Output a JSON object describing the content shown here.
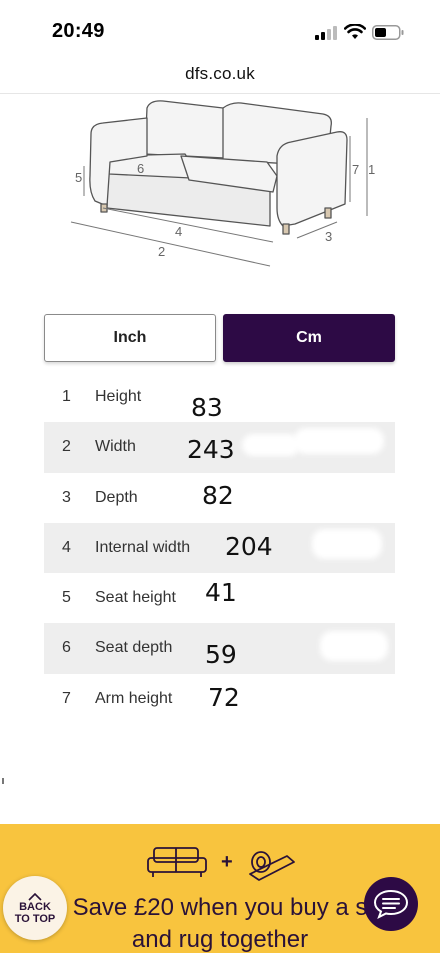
{
  "status_bar": {
    "time": "20:49"
  },
  "browser": {
    "url": "dfs.co.uk"
  },
  "diagram": {
    "labels": [
      "1",
      "2",
      "3",
      "4",
      "5",
      "6",
      "7"
    ]
  },
  "unit_toggle": {
    "options": [
      {
        "label": "Inch",
        "selected": false
      },
      {
        "label": "Cm",
        "selected": true
      }
    ]
  },
  "dimensions": [
    {
      "num": "1",
      "label": "Height",
      "value": "83"
    },
    {
      "num": "2",
      "label": "Width",
      "value": "243"
    },
    {
      "num": "3",
      "label": "Depth",
      "value": "82"
    },
    {
      "num": "4",
      "label": "Internal width",
      "value": "204"
    },
    {
      "num": "5",
      "label": "Seat height",
      "value": "41"
    },
    {
      "num": "6",
      "label": "Seat depth",
      "value": "59"
    },
    {
      "num": "7",
      "label": "Arm height",
      "value": "72"
    }
  ],
  "promo": {
    "line1": "Save £20 when you buy a s",
    "line2": "and rug together",
    "plus": "+"
  },
  "back_to_top": {
    "line1": "BACK",
    "line2": "TO TOP"
  },
  "colors": {
    "brand_purple": "#2d0a45",
    "promo_yellow": "#f8c43e",
    "row_shade": "#eeeeee"
  },
  "icons": {
    "signal": "cellular-signal-icon",
    "wifi": "wifi-icon",
    "battery": "battery-icon",
    "sofa": "sofa-icon",
    "rug": "rug-icon",
    "chat": "chat-icon",
    "back_to_top": "chevron-up-icon"
  }
}
